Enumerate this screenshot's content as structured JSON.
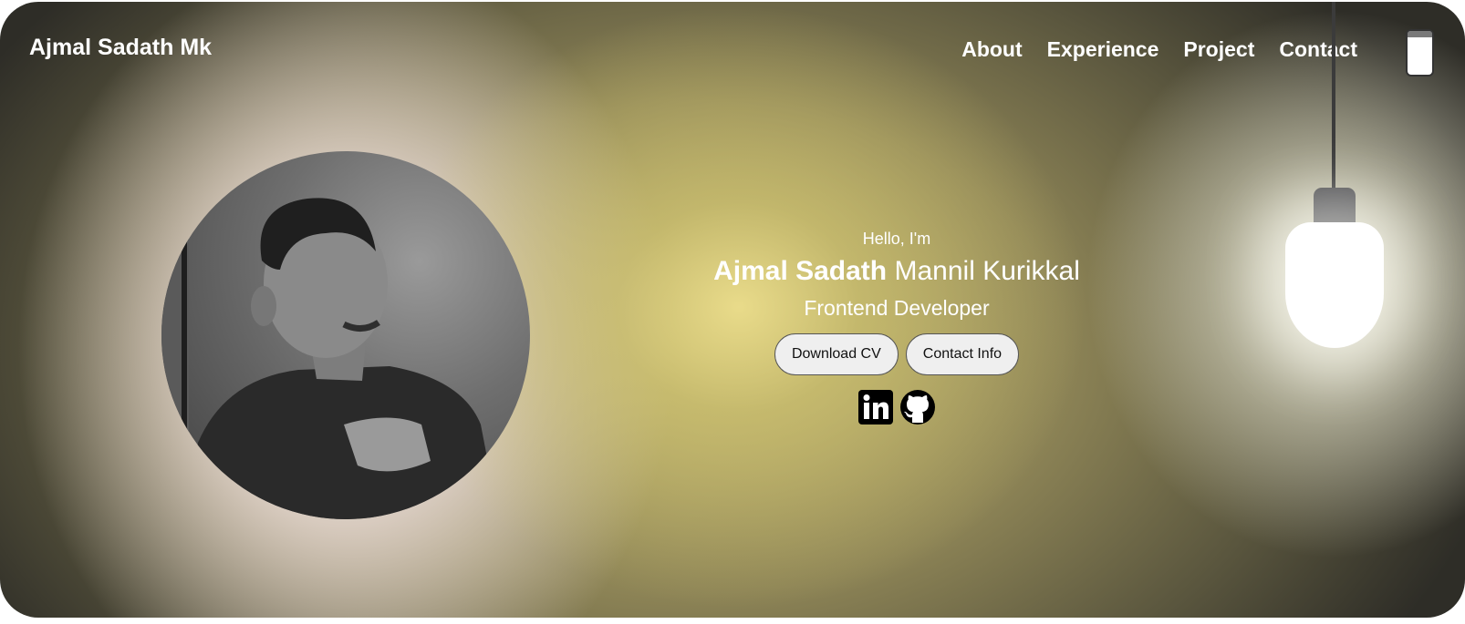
{
  "header": {
    "logo": "Ajmal Sadath Mk",
    "nav": [
      "About",
      "Experience",
      "Project",
      "Contact"
    ],
    "theme_toggle_icon": "phone-toggle-icon"
  },
  "hero": {
    "greeting": "Hello, I'm",
    "name_first": "Ajmal Sadath",
    "name_last": "Mannil Kurikkal",
    "role": "Frontend Developer",
    "buttons": [
      "Download CV",
      "Contact Info"
    ],
    "socials": [
      "linkedin-icon",
      "github-icon"
    ]
  },
  "decor": {
    "lamp_icon": "light-bulb-icon"
  },
  "colors": {
    "text": "#ffffff",
    "button_bg": "#efefef",
    "icon": "#000000"
  }
}
